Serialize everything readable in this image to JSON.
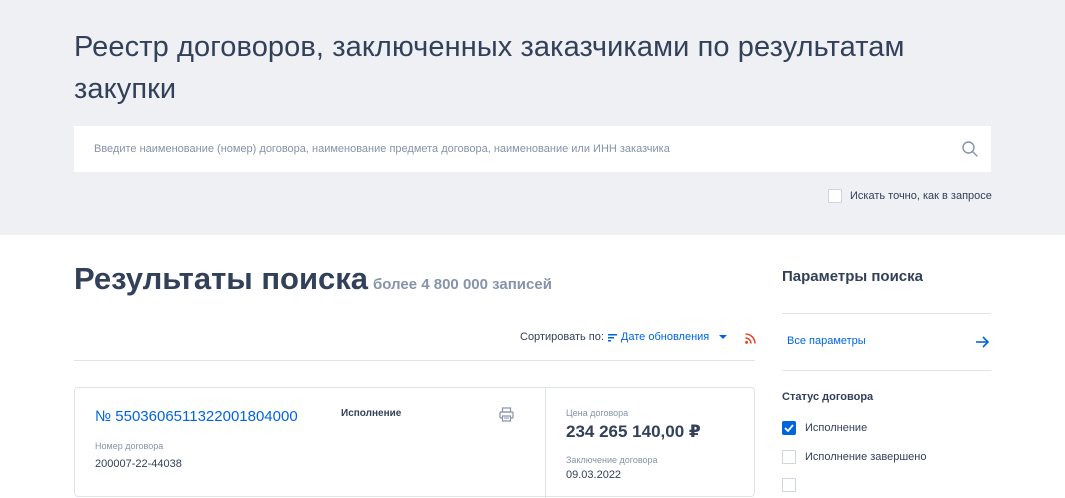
{
  "header": {
    "title": "Реестр договоров, заключенных заказчиками по результатам закупки"
  },
  "search": {
    "placeholder": "Введите наименование (номер) договора, наименование предмета договора, наименование или ИНН заказчика",
    "value": "",
    "exact_label": "Искать точно, как в запросе",
    "exact_checked": false
  },
  "results": {
    "title": "Результаты поиска",
    "count": "более 4 800 000 записей",
    "sort_label": "Сортировать по:",
    "sort_value": "Дате обновления"
  },
  "contract": {
    "number": "№ 5503606511322001804000",
    "status": "Исполнение",
    "contract_number_label": "Номер договора",
    "contract_number": "200007-22-44038",
    "price_label": "Цена договора",
    "price": "234 265 140,00 ₽",
    "conclusion_label": "Заключение договора",
    "conclusion_date": "09.03.2022"
  },
  "sidebar": {
    "title": "Параметры поиска",
    "all_params": "Все параметры",
    "status_title": "Статус договора",
    "options": [
      {
        "label": "Исполнение",
        "checked": true
      },
      {
        "label": "Исполнение завершено",
        "checked": false
      }
    ]
  },
  "colors": {
    "accent": "#0065dd",
    "text": "#334059",
    "muted": "#8693a8",
    "header_bg": "#eef0f3",
    "rss": "#e8442b"
  },
  "icons": [
    "search-icon",
    "sort-icon",
    "chevron-down-icon",
    "rss-icon",
    "print-icon",
    "arrow-right-icon",
    "check-icon"
  ]
}
